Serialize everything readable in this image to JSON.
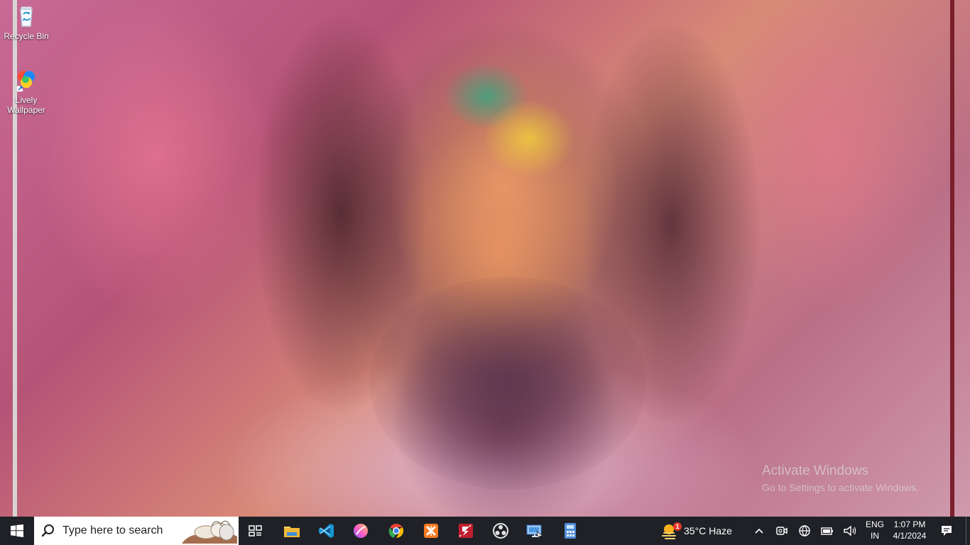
{
  "desktop": {
    "icons": [
      {
        "label": "Recycle Bin",
        "icon": "recycle-bin-icon"
      },
      {
        "label": "Lively Wallpaper",
        "icon": "lively-wallpaper-icon"
      }
    ],
    "activation": {
      "title": "Activate Windows",
      "subtitle": "Go to Settings to activate Windows."
    }
  },
  "taskbar": {
    "search": {
      "placeholder": "Type here to search"
    },
    "apps": [
      {
        "name": "Task View",
        "icon": "task-view-icon"
      },
      {
        "name": "File Explorer",
        "icon": "file-explorer-icon"
      },
      {
        "name": "Visual Studio Code",
        "icon": "vscode-icon"
      },
      {
        "name": "Paint",
        "icon": "paint-icon"
      },
      {
        "name": "Google Chrome",
        "icon": "chrome-icon"
      },
      {
        "name": "XAMPP",
        "icon": "xampp-icon"
      },
      {
        "name": "FileZilla",
        "icon": "filezilla-icon"
      },
      {
        "name": "OBS Studio",
        "icon": "obs-icon"
      },
      {
        "name": "Remote Desktop",
        "icon": "remote-desktop-icon"
      },
      {
        "name": "Calculator",
        "icon": "calculator-icon"
      }
    ],
    "weather": {
      "text": "35°C  Haze",
      "badge": "1",
      "icon": "weather-haze-icon"
    },
    "tray": {
      "language_line1": "ENG",
      "language_line2": "IN",
      "time": "1:07 PM",
      "date": "4/1/2024"
    }
  },
  "colors": {
    "taskbar_bg": "#1f2127",
    "search_bg": "#ffffff",
    "vscode_blue": "#1793d1",
    "chrome_red": "#ea4335",
    "chrome_yellow": "#fbbc05",
    "chrome_green": "#34a853",
    "chrome_blue": "#4285f4",
    "filezilla_red": "#bf1e2e",
    "xampp_orange": "#fb7a24"
  }
}
